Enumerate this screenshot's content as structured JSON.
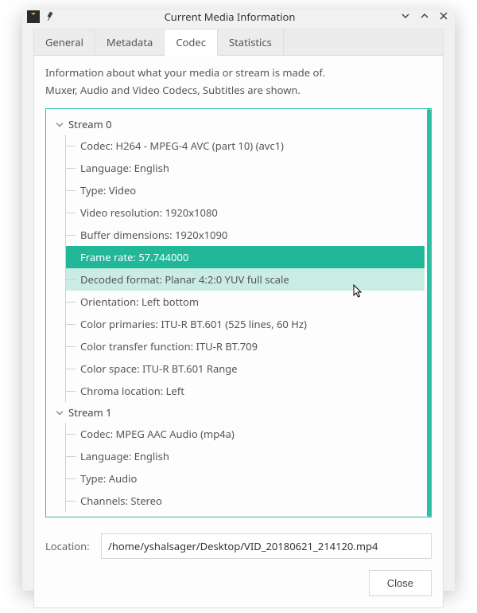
{
  "window": {
    "title": "Current Media Information"
  },
  "tabs": [
    {
      "label": "General",
      "active": false
    },
    {
      "label": "Metadata",
      "active": false
    },
    {
      "label": "Codec",
      "active": true
    },
    {
      "label": "Statistics",
      "active": false
    }
  ],
  "info_line1": "Information about what your media or stream is made of.",
  "info_line2": "Muxer, Audio and Video Codecs, Subtitles are shown.",
  "streams": [
    {
      "label": "Stream 0",
      "items": [
        {
          "text": "Codec: H264 - MPEG-4 AVC (part 10) (avc1)"
        },
        {
          "text": "Language: English"
        },
        {
          "text": "Type: Video"
        },
        {
          "text": "Video resolution: 1920x1080"
        },
        {
          "text": "Buffer dimensions: 1920x1090"
        },
        {
          "text": "Frame rate: 57.744000",
          "selected": true
        },
        {
          "text": "Decoded format: Planar 4:2:0 YUV full scale",
          "hover": true
        },
        {
          "text": "Orientation: Left bottom"
        },
        {
          "text": "Color primaries: ITU-R BT.601 (525 lines, 60 Hz)"
        },
        {
          "text": "Color transfer function: ITU-R BT.709"
        },
        {
          "text": "Color space: ITU-R BT.601 Range"
        },
        {
          "text": "Chroma location: Left"
        }
      ]
    },
    {
      "label": "Stream 1",
      "items": [
        {
          "text": "Codec: MPEG AAC Audio (mp4a)"
        },
        {
          "text": "Language: English"
        },
        {
          "text": "Type: Audio"
        },
        {
          "text": "Channels: Stereo"
        }
      ]
    }
  ],
  "location_label": "Location:",
  "location_value": "/home/yshalsager/Desktop/VID_20180621_214120.mp4",
  "close_label": "Close"
}
